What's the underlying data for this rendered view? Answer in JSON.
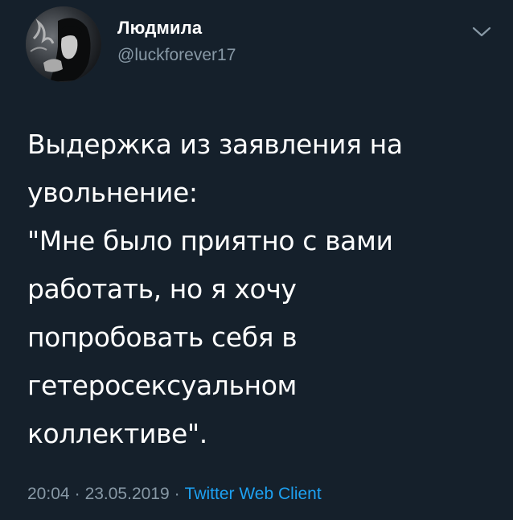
{
  "author": {
    "display_name": "Людмила",
    "handle": "@luckforever17"
  },
  "tweet": {
    "lines": [
      "Выдержка из заявления на",
      "увольнение:",
      "\"Мне было приятно с вами",
      "работать, но я хочу",
      "попробовать себя в",
      "гетеросексуальном",
      "коллективе\"."
    ]
  },
  "meta": {
    "time": "20:04",
    "separator": "·",
    "date": "23.05.2019",
    "source": "Twitter Web Client"
  },
  "icons": {
    "more": "chevron-down-icon"
  },
  "colors": {
    "background": "#15202b",
    "text": "#ffffff",
    "secondary": "#8899a6",
    "accent": "#1da1f2"
  }
}
